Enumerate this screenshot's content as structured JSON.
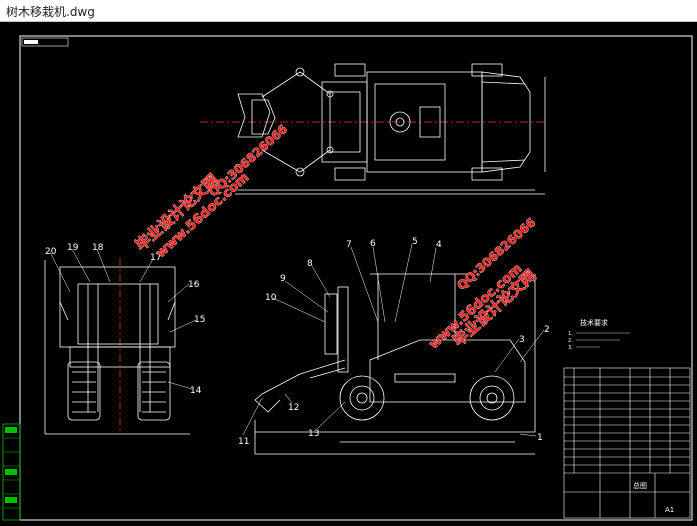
{
  "window": {
    "title": "树木移栽机.dwg"
  },
  "watermarks": {
    "site_a": "毕业设计论文网",
    "url_a": "www.56doc.com",
    "qq_a": "QQ:306826066",
    "site_b": "毕业设计论文网",
    "url_b": "www.56doc.com",
    "qq_b": "QQ:306826066"
  },
  "callouts": [
    "1",
    "2",
    "3",
    "4",
    "5",
    "6",
    "7",
    "8",
    "9",
    "10",
    "11",
    "12",
    "13",
    "14",
    "15",
    "16",
    "17",
    "18",
    "19",
    "20"
  ],
  "tech_req": {
    "title": "技术要求",
    "lines": [
      "1.",
      "2.",
      "3."
    ]
  },
  "title_block": {
    "name": "总图",
    "sheet": "A1"
  },
  "colors": {
    "background": "#000000",
    "lines": "#ffffff",
    "watermark": "#ff2020",
    "frame_left": "#00c000"
  }
}
